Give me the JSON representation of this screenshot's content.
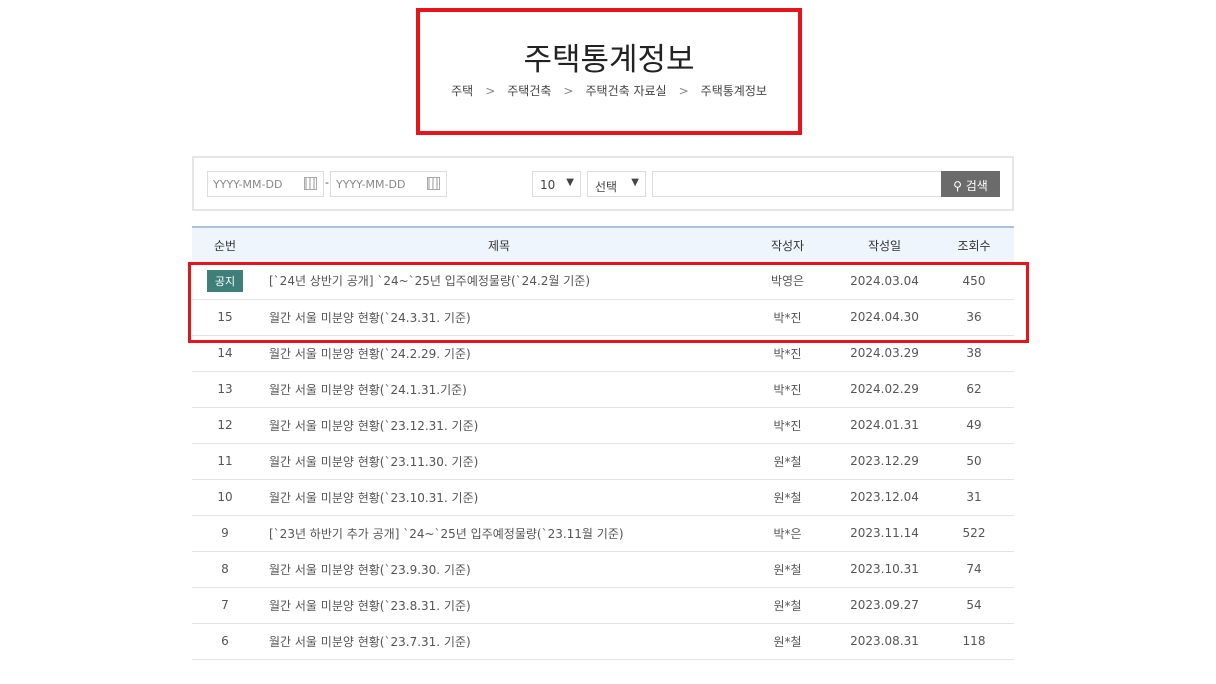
{
  "header": {
    "title": "주택통계정보",
    "breadcrumb": [
      "주택",
      "주택건축",
      "주택건축 자료실",
      "주택통계정보"
    ],
    "separator": ">"
  },
  "search": {
    "date_from_placeholder": "YYYY-MM-DD",
    "date_to_placeholder": "YYYY-MM-DD",
    "date_separator": "-",
    "page_size": "10",
    "field": "선택",
    "keyword": "",
    "button": "검색"
  },
  "table": {
    "headers": [
      "순번",
      "제목",
      "작성자",
      "작성일",
      "조회수"
    ],
    "rows": [
      {
        "no": "공지",
        "title": "[`24년 상반기 공개] `24~`25년 입주예정물량(`24.2월 기준)",
        "author": "박영은",
        "date": "2024.03.04",
        "views": "450"
      },
      {
        "no": "15",
        "title": "월간 서울 미분양 현황(`24.3.31. 기준)",
        "author": "박*진",
        "date": "2024.04.30",
        "views": "36"
      },
      {
        "no": "14",
        "title": "월간 서울 미분양 현황(`24.2.29. 기준)",
        "author": "박*진",
        "date": "2024.03.29",
        "views": "38"
      },
      {
        "no": "13",
        "title": "월간 서울 미분양 현황(`24.1.31.기준)",
        "author": "박*진",
        "date": "2024.02.29",
        "views": "62"
      },
      {
        "no": "12",
        "title": "월간 서울 미분양 현황(`23.12.31. 기준)",
        "author": "박*진",
        "date": "2024.01.31",
        "views": "49"
      },
      {
        "no": "11",
        "title": "월간 서울 미분양 현황(`23.11.30. 기준)",
        "author": "원*철",
        "date": "2023.12.29",
        "views": "50"
      },
      {
        "no": "10",
        "title": "월간 서울 미분양 현황(`23.10.31. 기준)",
        "author": "원*철",
        "date": "2023.12.04",
        "views": "31"
      },
      {
        "no": "9",
        "title": "[`23년 하반기 추가 공개] `24~`25년 입주예정물량(`23.11월 기준)",
        "author": "박*은",
        "date": "2023.11.14",
        "views": "522"
      },
      {
        "no": "8",
        "title": "월간 서울 미분양 현황(`23.9.30. 기준)",
        "author": "원*철",
        "date": "2023.10.31",
        "views": "74"
      },
      {
        "no": "7",
        "title": "월간 서울 미분양 현황(`23.8.31. 기준)",
        "author": "원*철",
        "date": "2023.09.27",
        "views": "54"
      },
      {
        "no": "6",
        "title": "월간 서울 미분양 현황(`23.7.31. 기준)",
        "author": "원*철",
        "date": "2023.08.31",
        "views": "118"
      }
    ]
  },
  "colors": {
    "highlight": "#e8141b",
    "badge": "#3e7f7a",
    "button": "#6b6b6b",
    "header_bg": "#eef5fd"
  }
}
